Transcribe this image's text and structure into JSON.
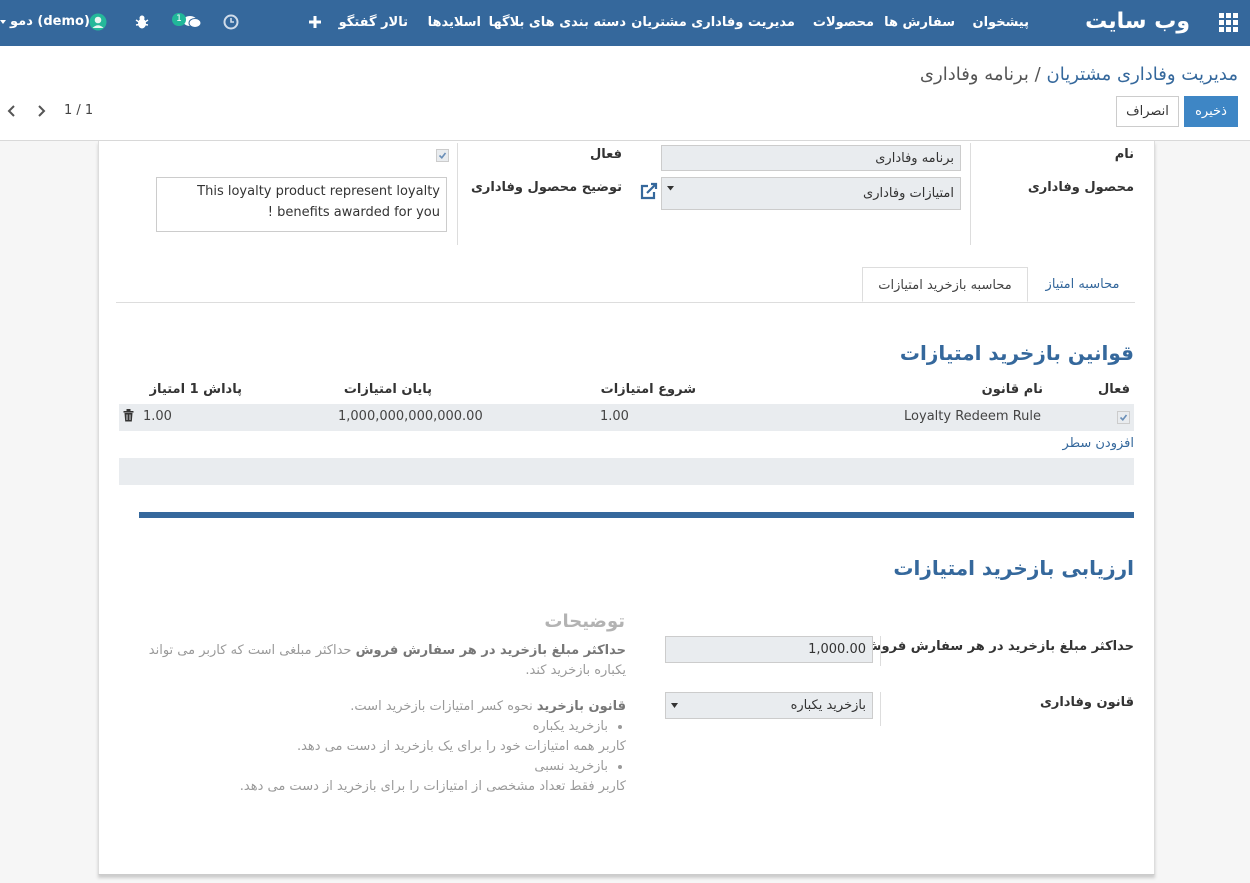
{
  "navbar": {
    "brand": "وب سایت",
    "menu": [
      "پیشخوان",
      "سفارش ها",
      "محصولات",
      "مدیریت وفاداری مشتریان",
      "دسته بندی های بلاگها",
      "اسلایدها",
      "تالار گفتگو"
    ],
    "chat_count": "1",
    "user": "دمو (demo)"
  },
  "breadcrumb": {
    "parent": "مدیریت وفاداری مشتریان",
    "separator": "/",
    "current": "برنامه وفاداری"
  },
  "buttons": {
    "save": "ذخیره",
    "cancel": "انصراف"
  },
  "pager": "1 / 1",
  "form": {
    "name_label": "نام",
    "name_value": "برنامه وفاداری",
    "product_label": "محصول وفاداری",
    "product_value": "امتیازات وفاداری",
    "active_label": "فعال",
    "active_checked": true,
    "description_label": "توضیح محصول وفاداری",
    "description_value": "This loyalty product represent loyalty benefits awarded for you !"
  },
  "tabs": [
    "محاسبه امتیاز",
    "محاسبه بازخرید امتیازات"
  ],
  "redeem_rules": {
    "title": "قوانین بازخرید امتیازات",
    "columns": [
      "فعال",
      "نام قانون",
      "شروع امتیازات",
      "پایان امتیازات",
      "پاداش 1 امتیاز"
    ],
    "rows": [
      {
        "active": true,
        "name": "Loyalty Redeem Rule",
        "start": "1.00",
        "end": "1,000,000,000,000.00",
        "reward": "1.00"
      }
    ],
    "add_line": "افزودن سطر"
  },
  "evaluation": {
    "title": "ارزیابی بازخرید امتیازات",
    "max_label": "حداکثر مبلغ بازخرید در هر سفارش فروش",
    "max_value": "1,000.00",
    "rule_label": "قانون وفاداری",
    "rule_value": "بازخرید یکباره",
    "help_title": "توضیحات",
    "help_max_bold": "حداکثر مبلغ بازخرید در هر سفارش فروش",
    "help_max_text": " حداکثر مبلغی است که کاربر می تواند یکباره بازخرید کند.",
    "help_rule_bold": "قانون بازخرید",
    "help_rule_text": " نحوه کسر امتیازات بازخرید است.",
    "help_once_title": "بازخرید یکباره",
    "help_once_text": "کاربر همه امتیازات خود را برای یک بازخرید از دست می دهد.",
    "help_partial_title": "بازخرید نسبی",
    "help_partial_text": "کاربر فقط تعداد مشخصی از امتیازات را برای بازخرید از دست می دهد."
  }
}
